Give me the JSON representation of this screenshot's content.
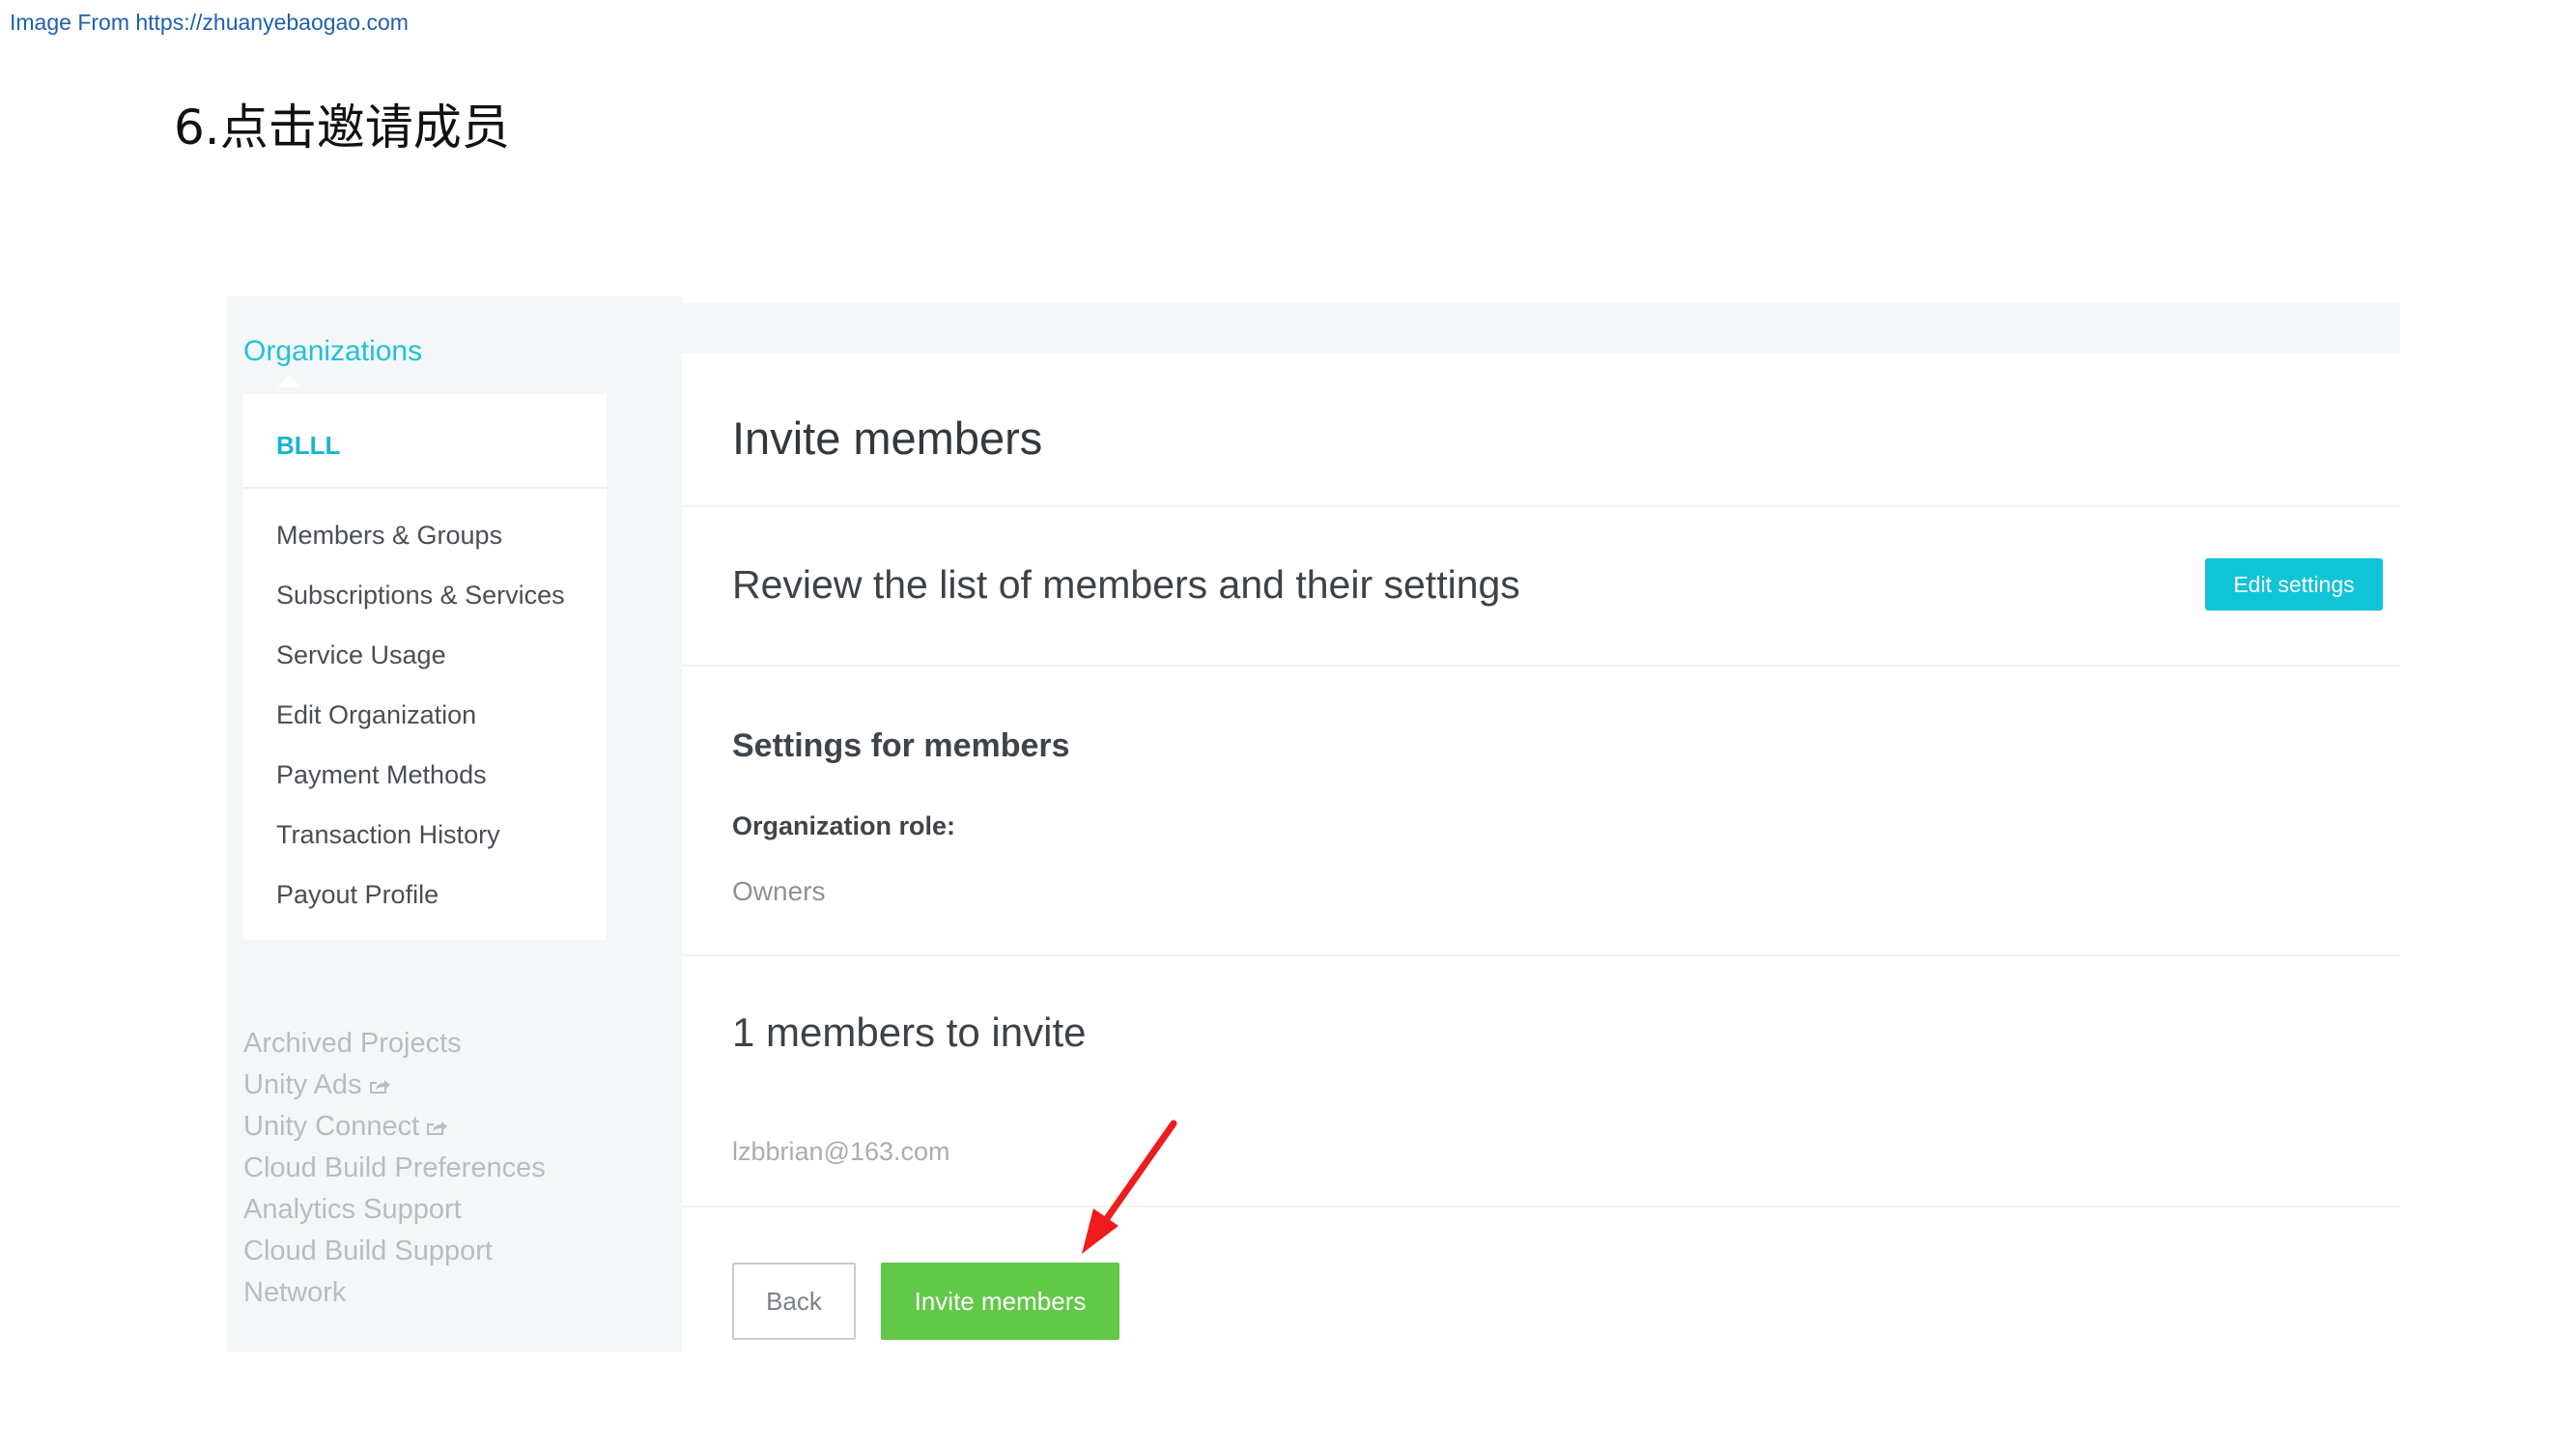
{
  "source": {
    "text": "Image From https://zhuanyebaogao.com"
  },
  "step": {
    "title": "6.点击邀请成员"
  },
  "sidebar": {
    "heading": "Organizations",
    "org_name": "BLLL",
    "menu": [
      "Members & Groups",
      "Subscriptions & Services",
      "Service Usage",
      "Edit Organization",
      "Payment Methods",
      "Transaction History",
      "Payout Profile"
    ],
    "links": [
      {
        "label": "Archived Projects",
        "icon": ""
      },
      {
        "label": "Unity Ads",
        "icon": "external-link-icon"
      },
      {
        "label": "Unity Connect",
        "icon": "external-link-icon"
      },
      {
        "label": "Cloud Build Preferences",
        "icon": ""
      },
      {
        "label": "Analytics Support",
        "icon": ""
      },
      {
        "label": "Cloud Build Support",
        "icon": ""
      },
      {
        "label": "Network",
        "icon": ""
      }
    ]
  },
  "main": {
    "title": "Invite members",
    "review_heading": "Review the list of members and their settings",
    "edit_settings_label": "Edit settings",
    "settings_heading": "Settings for members",
    "role_label": "Organization role:",
    "role_value": "Owners",
    "count_heading": "1 members to invite",
    "invitee_email": "lzbbrian@163.com",
    "back_label": "Back",
    "invite_label": "Invite members"
  },
  "colors": {
    "accent": "#22c1d6",
    "primary_button": "#62c848",
    "annotation_arrow": "#ee1c1c"
  }
}
